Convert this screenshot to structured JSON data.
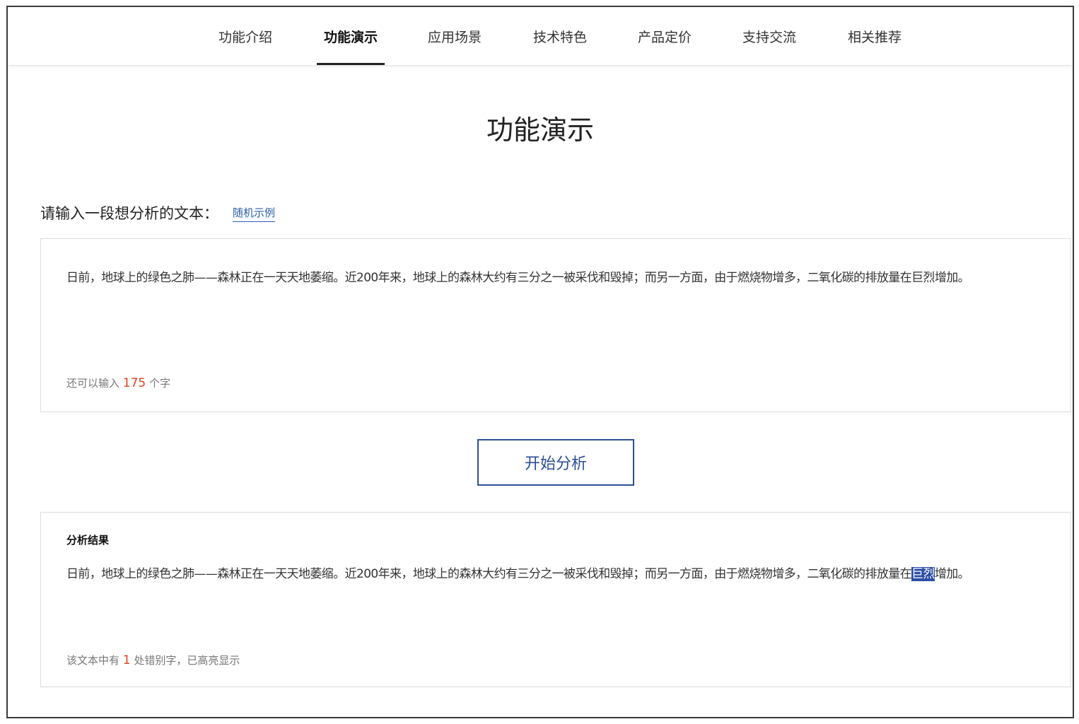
{
  "nav": {
    "tabs": [
      {
        "label": "功能介绍",
        "active": false
      },
      {
        "label": "功能演示",
        "active": true
      },
      {
        "label": "应用场景",
        "active": false
      },
      {
        "label": "技术特色",
        "active": false
      },
      {
        "label": "产品定价",
        "active": false
      },
      {
        "label": "支持交流",
        "active": false
      },
      {
        "label": "相关推荐",
        "active": false
      }
    ]
  },
  "page": {
    "title": "功能演示"
  },
  "input": {
    "prompt": "请输入一段想分析的文本：",
    "random_example": "随机示例",
    "text": "日前，地球上的绿色之肺——森林正在一天天地萎缩。近200年来，地球上的森林大约有三分之一被采伐和毁掉；而另一方面，由于燃烧物增多，二氧化碳的排放量在巨烈增加。",
    "remaining_prefix": "还可以输入",
    "remaining_count": "175",
    "remaining_suffix": "个字"
  },
  "actions": {
    "start_label": "开始分析"
  },
  "result": {
    "title": "分析结果",
    "text_before": "日前，地球上的绿色之肺——森林正在一天天地萎缩。近200年来，地球上的森林大约有三分之一被采伐和毁掉；而另一方面，由于燃烧物增多，二氧化碳的排放量在",
    "highlight": "巨烈",
    "text_after": "增加。",
    "summary_prefix": "该文本中有",
    "summary_count": "1",
    "summary_suffix": "处错别字，已高亮显示"
  },
  "colors": {
    "accent_blue": "#2c4f95",
    "highlight_bg": "#2b4ea6",
    "count_red": "#e0411f"
  }
}
